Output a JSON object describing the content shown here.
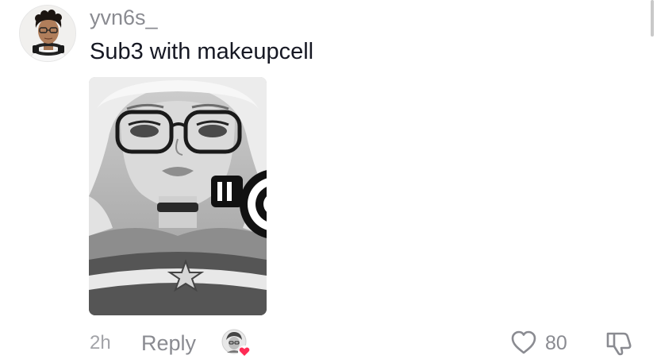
{
  "comment": {
    "username": "yvn6s_",
    "text": "Sub3 with makeupcell",
    "time": "2h",
    "reply_label": "Reply",
    "like_count": "80",
    "has_image_attachment": true,
    "liked_by_creator": true
  },
  "icons": {
    "avatar": "user-avatar",
    "like": "heart-outline-icon",
    "dislike": "thumbs-down-icon",
    "creator_liked": "creator-avatar-heart-badge-icon"
  },
  "colors": {
    "text_primary": "#161823",
    "text_secondary": "#8a8b91",
    "heart_badge": "#fe2c55"
  }
}
